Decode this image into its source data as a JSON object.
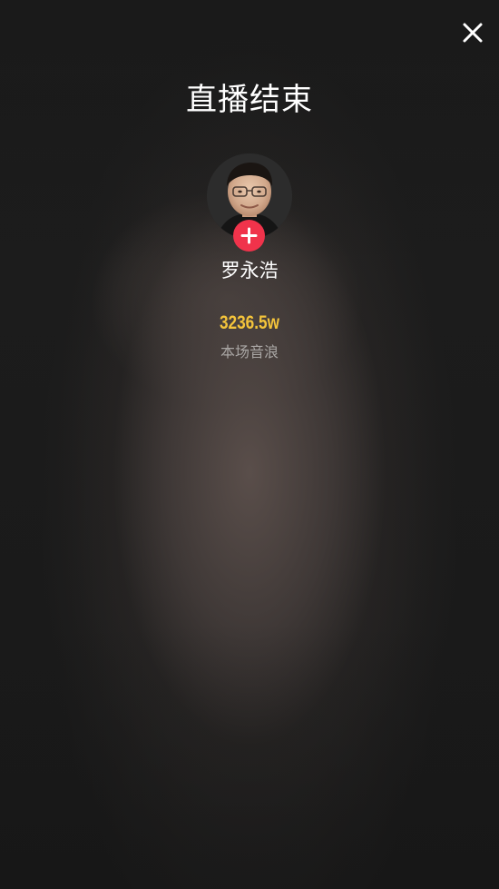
{
  "page": {
    "title": "直播结束"
  },
  "header": {
    "close_icon": "close-icon"
  },
  "host": {
    "name": "罗永浩",
    "avatar_icon": "avatar",
    "follow_icon": "plus-icon"
  },
  "stats": {
    "value": "3236.5w",
    "label": "本场音浪"
  },
  "colors": {
    "background": "#1c1c1c",
    "follow_button": "#f0334b",
    "stat_value": "#f4c43b",
    "stat_label": "#a9a6a4"
  }
}
